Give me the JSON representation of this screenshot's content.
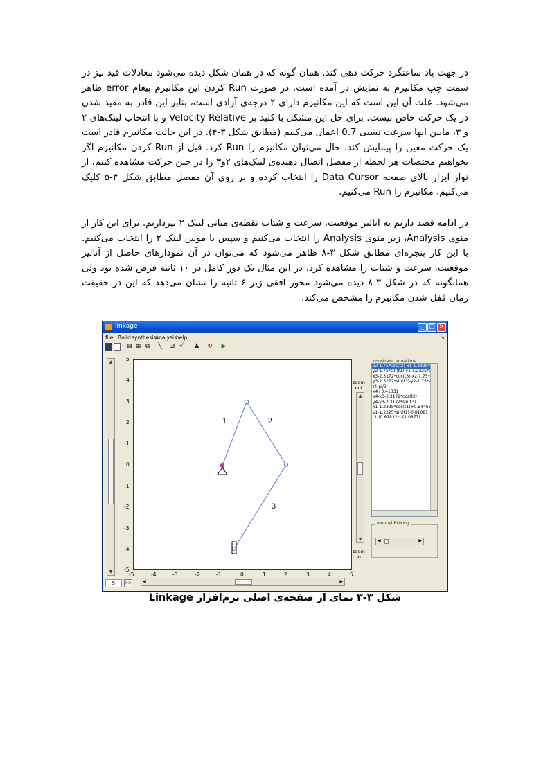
{
  "paragraphs": [
    "در جهت پاد ساعتگرد حرکت دهی کند. همان گونه که در همان شکل دیده می‌شود معادلات فید نیز در سمت چپ مکانیزم به نمایش در آمده است. در صورت Run کردن این مکانیزم پیغام error ظاهر می‌شود. علت آن این است که این مکانیزم دارای ۲ درجه‌ی آزادی است، بنابر این قادر به مقید شدن در یک حرکت خاص نیست. برای حل این مشکل با کلید بر Velocity Relative و با انتخاب لینک‌های ۲ و ۳، مابین آنها سرعت نسبی 0.7 اعمال می‌کنیم (مطابق شکل ۳-۴). در این حالت مکانیزم قادر است یک حرکت معین را پیمایش کند. حال می‌توان مکانیزم را Run کرد. قبل از Run کردن مکانیزم اگر بخواهیم مختصات هر لحظه از مفصل اتصال دهنده‌ی لینک‌های ۲و۳ را در حین حرکت مشاهده کنیم، از نوار ابزار بالای صفحه Data Cursor را انتخاب کرده و بر روی آن مفصل مطابق شکل ۳-۵ کلیک می‌کنیم. مکانیزم را Run می‌کنیم.",
    "در ادامه قصد داریم به آنالیز موقعیت، سرعت و شتاب نقطه‌ی میانی لینک ۲ بپردازیم. برای این کار از منوی Analysis، زیر منوی Analysis را انتخاب می‌کنیم و سپس با موس لینک ۲ را انتخاب می‌کنیم. با این کار پنجره‌ای مطابق شکل ۳-۸ ظاهر می‌شود که می‌توان در آن نمودارهای حاصل از آنالیز موقعیت، سرعت و شتاب را مشاهده کرد. در این مثال یک دور کامل در ۱۰ ثانیه فرض شده بود ولی همانگونه که در شکل ۳-۸ دیده می‌شود محور افقی زیر ۶ ثانیه را نشان می‌دهد که این در حقیقت زمان قفل شدن مکانیزم را مشخص می‌کند."
  ],
  "window": {
    "title": "linkage",
    "min": "_",
    "max": "□",
    "close": "✕",
    "menu": [
      "file",
      "Build",
      "synthesis",
      "Analysis",
      "help"
    ],
    "menu_arrow": "↘"
  },
  "toolbar_icons": [
    "save-icon",
    "new-icon",
    "box-icon",
    "grid-icon",
    "select-icon",
    "line-icon",
    "link-icon",
    "check-icon",
    "person-icon",
    "refresh-icon",
    "play-icon"
  ],
  "axis": {
    "x_ticks": [
      "-5",
      "-4",
      "-3",
      "-2",
      "-1",
      "0",
      "1",
      "2",
      "3",
      "4",
      "5"
    ],
    "y_ticks": [
      "5",
      "4",
      "3",
      "2",
      "1",
      "0",
      "-1",
      "-2",
      "-3",
      "-4",
      "-5"
    ]
  },
  "link_labels": [
    "1",
    "2",
    "3"
  ],
  "zoom_out": "zoom out",
  "zoom_in": "zoom in",
  "constraint_label": "constreint equations",
  "constraints": [
    "x2-1.75*cos(t2)-x1-1.2325*co",
    "y2-1.75*sin(t2)-y1-1.2325*sin",
    "x3-2.3172*cos(t3)-x2-1.75*co",
    "y3-2.3172*sin(t3)-y2-1.75*sin",
    "t4-pi/2",
    "x4+3.41031",
    "x4-x3-2.3172*cos(t3)",
    "y4-y3-2.3172*sin(t3)",
    "x1-1.2325*cos(t1)+0.54466",
    "y1-1.2325*sin(t1)-0.81081",
    "t1-(0.62832*t-(1.0877)"
  ],
  "manual_label": "menuel RUNing",
  "step_value": "5",
  "step_button": ">>",
  "caption": "شکل ۳-۳ نمای از صفحه‌ی اصلی نرم‌افزار Linkage",
  "mechanism": {
    "ground_pivot": [
      -1,
      0.8
    ],
    "joint_12": [
      0.2,
      3
    ],
    "joint_23": [
      2,
      0
    ],
    "slider_end": [
      -0.4,
      -4
    ]
  }
}
